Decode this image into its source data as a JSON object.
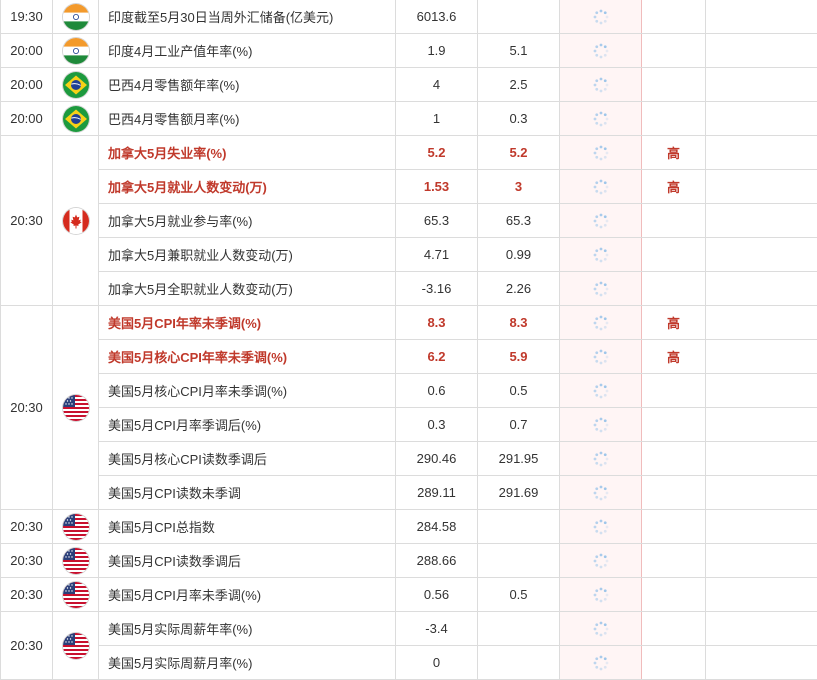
{
  "colors": {
    "highlight": "#c0392b",
    "border": "#dcdcdc",
    "actual_bg": "#fff5f5",
    "spinner": "#9ec6ea"
  },
  "groups": [
    {
      "time": "19:30",
      "flag": "india-flag-icon",
      "rows": [
        {
          "name": "印度截至5月30日当周外汇储备(亿美元)",
          "prev": "6013.6",
          "forecast": "",
          "importance": "",
          "hi": false
        }
      ]
    },
    {
      "time": "20:00",
      "flag": "india-flag-icon",
      "rows": [
        {
          "name": "印度4月工业产值年率(%)",
          "prev": "1.9",
          "forecast": "5.1",
          "importance": "",
          "hi": false
        }
      ]
    },
    {
      "time": "20:00",
      "flag": "brazil-flag-icon",
      "rows": [
        {
          "name": "巴西4月零售额年率(%)",
          "prev": "4",
          "forecast": "2.5",
          "importance": "",
          "hi": false
        }
      ]
    },
    {
      "time": "20:00",
      "flag": "brazil-flag-icon",
      "rows": [
        {
          "name": "巴西4月零售额月率(%)",
          "prev": "1",
          "forecast": "0.3",
          "importance": "",
          "hi": false
        }
      ]
    },
    {
      "time": "20:30",
      "flag": "canada-flag-icon",
      "rows": [
        {
          "name": "加拿大5月失业率(%)",
          "prev": "5.2",
          "forecast": "5.2",
          "importance": "高",
          "hi": true
        },
        {
          "name": "加拿大5月就业人数变动(万)",
          "prev": "1.53",
          "forecast": "3",
          "importance": "高",
          "hi": true
        },
        {
          "name": "加拿大5月就业参与率(%)",
          "prev": "65.3",
          "forecast": "65.3",
          "importance": "",
          "hi": false
        },
        {
          "name": "加拿大5月兼职就业人数变动(万)",
          "prev": "4.71",
          "forecast": "0.99",
          "importance": "",
          "hi": false
        },
        {
          "name": "加拿大5月全职就业人数变动(万)",
          "prev": "-3.16",
          "forecast": "2.26",
          "importance": "",
          "hi": false
        }
      ]
    },
    {
      "time": "20:30",
      "flag": "usa-flag-icon",
      "rows": [
        {
          "name": "美国5月CPI年率未季调(%)",
          "prev": "8.3",
          "forecast": "8.3",
          "importance": "高",
          "hi": true
        },
        {
          "name": "美国5月核心CPI年率未季调(%)",
          "prev": "6.2",
          "forecast": "5.9",
          "importance": "高",
          "hi": true
        },
        {
          "name": "美国5月核心CPI月率未季调(%)",
          "prev": "0.6",
          "forecast": "0.5",
          "importance": "",
          "hi": false
        },
        {
          "name": "美国5月CPI月率季调后(%)",
          "prev": "0.3",
          "forecast": "0.7",
          "importance": "",
          "hi": false
        },
        {
          "name": "美国5月核心CPI读数季调后",
          "prev": "290.46",
          "forecast": "291.95",
          "importance": "",
          "hi": false
        },
        {
          "name": "美国5月CPI读数未季调",
          "prev": "289.11",
          "forecast": "291.69",
          "importance": "",
          "hi": false
        }
      ]
    },
    {
      "time": "20:30",
      "flag": "usa-flag-icon",
      "rows": [
        {
          "name": "美国5月CPI总指数",
          "prev": "284.58",
          "forecast": "",
          "importance": "",
          "hi": false
        }
      ]
    },
    {
      "time": "20:30",
      "flag": "usa-flag-icon",
      "rows": [
        {
          "name": "美国5月CPI读数季调后",
          "prev": "288.66",
          "forecast": "",
          "importance": "",
          "hi": false
        }
      ]
    },
    {
      "time": "20:30",
      "flag": "usa-flag-icon",
      "rows": [
        {
          "name": "美国5月CPI月率未季调(%)",
          "prev": "0.56",
          "forecast": "0.5",
          "importance": "",
          "hi": false
        }
      ]
    },
    {
      "time": "20:30",
      "flag": "usa-flag-icon",
      "rows": [
        {
          "name": "美国5月实际周薪年率(%)",
          "prev": "-3.4",
          "forecast": "",
          "importance": "",
          "hi": false
        },
        {
          "name": "美国5月实际周薪月率(%)",
          "prev": "0",
          "forecast": "",
          "importance": "",
          "hi": false
        }
      ]
    }
  ]
}
